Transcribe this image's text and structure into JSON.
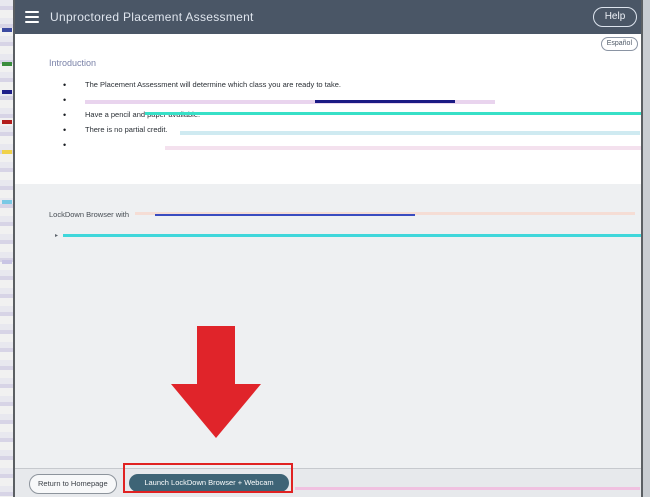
{
  "header": {
    "title": "Unproctored Placement Assessment",
    "help_label": "Help"
  },
  "content": {
    "language_label": "Español",
    "section_title": "Introduction",
    "bullets": [
      "The Placement Assessment will determine which class you are ready to take.",
      "",
      "Have a pencil and paper available.",
      "There is no partial credit.",
      ""
    ]
  },
  "lockdown": {
    "section_label": "LockDown Browser with"
  },
  "footer": {
    "return_label": "Return to Homepage",
    "launch_label": "Launch LockDown Browser + Webcam"
  },
  "colors": {
    "arrow": "#e0242a",
    "highlight": "#e02222",
    "launch": "#3e6476"
  }
}
